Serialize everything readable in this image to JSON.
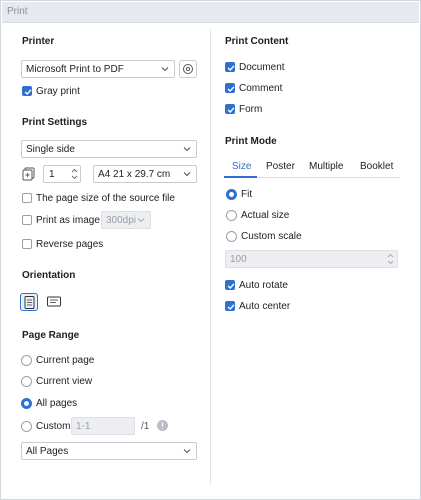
{
  "window": {
    "title": "Print"
  },
  "printer": {
    "heading": "Printer",
    "selected": "Microsoft Print to PDF",
    "gray_print": "Gray print"
  },
  "settings": {
    "heading": "Print Settings",
    "sides": "Single side",
    "copies": "1",
    "paper": "A4 21 x 29.7 cm",
    "source_size": "The page size of the source file",
    "print_as_image": "Print as image",
    "dpi": "300dpi",
    "reverse": "Reverse pages"
  },
  "orientation": {
    "heading": "Orientation"
  },
  "range": {
    "heading": "Page Range",
    "current_page": "Current page",
    "current_view": "Current view",
    "all_pages": "All pages",
    "custom": "Custom",
    "custom_placeholder": "1-1",
    "total": "/1",
    "subset": "All Pages"
  },
  "content": {
    "heading": "Print Content",
    "document": "Document",
    "comment": "Comment",
    "form": "Form"
  },
  "mode": {
    "heading": "Print Mode",
    "tabs": [
      "Size",
      "Poster",
      "Multiple",
      "Booklet"
    ],
    "fit": "Fit",
    "actual": "Actual size",
    "custom_scale": "Custom scale",
    "scale_value": "100",
    "auto_rotate": "Auto rotate",
    "auto_center": "Auto center"
  },
  "colors": {
    "accent": "#2f6fd1"
  }
}
